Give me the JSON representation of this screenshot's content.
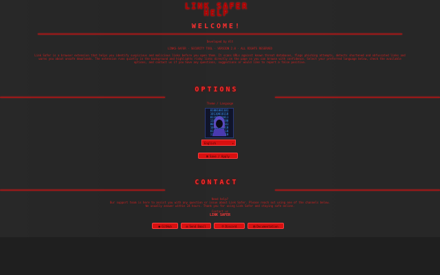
{
  "header": {
    "title_line1": "LINK SAFER",
    "title_line2": "HELP",
    "welcome": "WELCOME!"
  },
  "intro": {
    "author": "Developed by Alt",
    "meta": "LINKS-SAFER  ·  SECURITY TOOL  ·  VERSION 2.0  ·  ALL RIGHTS RESERVED",
    "paragraph": "Link Safer is a browser extension that helps you identify suspicious and malicious links before you open them. It scans URLs against known threat databases, flags phishing attempts, detects shortened and obfuscated links and warns you about unsafe downloads. The extension runs quietly in the background and highlights risky links directly on the page so you can browse with confidence. Select your preferred language below, check the available options, and contact us if you have any questions, suggestions or would like to report a false positive."
  },
  "options": {
    "heading": "OPTIONS",
    "theme_label": "Theme / Language",
    "avatar_icon": "hacker-hood-icon",
    "binary_rows": [
      "01001001101",
      "10110010110",
      "01101001011",
      "11010110100",
      "00110101101",
      "10101101010",
      "01011010110",
      "11001011010"
    ],
    "select_value": "English",
    "save_button": "Save / Apply"
  },
  "contact": {
    "heading": "CONTACT",
    "line1": "Need help?",
    "line2": "Our support team is here to assist you with any question or issue about Link Safer. Please reach out using one of the channels below.",
    "line3": "We usually answer within 24 hours. Thank you for using Link Safer and staying safe online.",
    "line4": "Contact us",
    "brand": "LINK SAFER",
    "buttons": [
      {
        "icon": "github-icon",
        "label": "GitHub"
      },
      {
        "icon": "email-icon",
        "label": "Send Email"
      },
      {
        "icon": "discord-icon",
        "label": "Discord"
      },
      {
        "icon": "document-icon",
        "label": "Documentation"
      }
    ]
  },
  "colors": {
    "accent": "#e01010",
    "background": "#161616"
  }
}
